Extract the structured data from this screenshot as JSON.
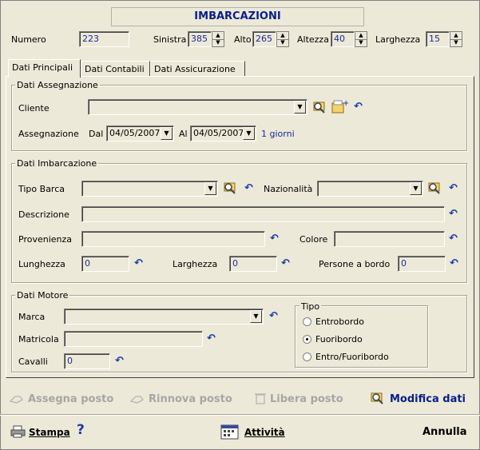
{
  "header": {
    "title": "IMBARCAZIONI"
  },
  "top_fields": {
    "numero_label": "Numero",
    "numero_value": "223",
    "sinistra_label": "Sinistra",
    "sinistra_value": "385",
    "alto_label": "Alto",
    "alto_value": "265",
    "altezza_label": "Altezza",
    "altezza_value": "40",
    "larghezza_label": "Larghezza",
    "larghezza_value": "15"
  },
  "tabs": [
    {
      "label": "Dati Principali",
      "active": true
    },
    {
      "label": "Dati Contabili",
      "active": false
    },
    {
      "label": "Dati Assicurazione",
      "active": false
    }
  ],
  "assegnazione": {
    "group_title": "Dati Assegnazione",
    "cliente_label": "Cliente",
    "cliente_value": "",
    "assegnazione_label": "Assegnazione",
    "dal_label": "Dal",
    "dal_value": "04/05/2007",
    "al_label": "Al",
    "al_value": "04/05/2007",
    "giorni_text": "1 giorni"
  },
  "imbarcazione": {
    "group_title": "Dati Imbarcazione",
    "tipo_barca_label": "Tipo Barca",
    "tipo_barca_value": "",
    "nazionalita_label": "Nazionalità",
    "nazionalita_value": "",
    "descrizione_label": "Descrizione",
    "descrizione_value": "",
    "provenienza_label": "Provenienza",
    "provenienza_value": "",
    "colore_label": "Colore",
    "colore_value": "",
    "lunghezza_label": "Lunghezza",
    "lunghezza_value": "0",
    "larghezza_label": "Larghezza",
    "larghezza_value": "0",
    "persone_label": "Persone a bordo",
    "persone_value": "0"
  },
  "motore": {
    "group_title": "Dati Motore",
    "marca_label": "Marca",
    "marca_value": "",
    "matricola_label": "Matricola",
    "matricola_value": "",
    "cavalli_label": "Cavalli",
    "cavalli_value": "0",
    "tipo_title": "Tipo",
    "tipo_options": [
      {
        "label": "Entrobordo",
        "selected": false
      },
      {
        "label": "Fuoribordo",
        "selected": true
      },
      {
        "label": "Entro/Fuoribordo",
        "selected": false
      }
    ]
  },
  "actions": {
    "assegna_posto": "Assegna posto",
    "rinnova_posto": "Rinnova posto",
    "libera_posto": "Libera posto",
    "modifica_dati": "Modifica dati"
  },
  "footer": {
    "stampa": "Stampa",
    "help": "?",
    "attivita": "Attività",
    "annulla": "Annulla"
  },
  "icons": {
    "search": "search-binoculars-icon",
    "add": "add-record-icon",
    "undo": "undo-arrow-icon",
    "assign": "hand-assign-icon",
    "renew": "hand-renew-icon",
    "free": "trash-free-icon",
    "edit": "edit-search-icon",
    "print": "printer-icon",
    "activity": "activity-calendar-icon"
  },
  "colors": {
    "accent": "#1a2a9a",
    "background": "#ECE9D8",
    "disabled": "#a6a6a6"
  }
}
